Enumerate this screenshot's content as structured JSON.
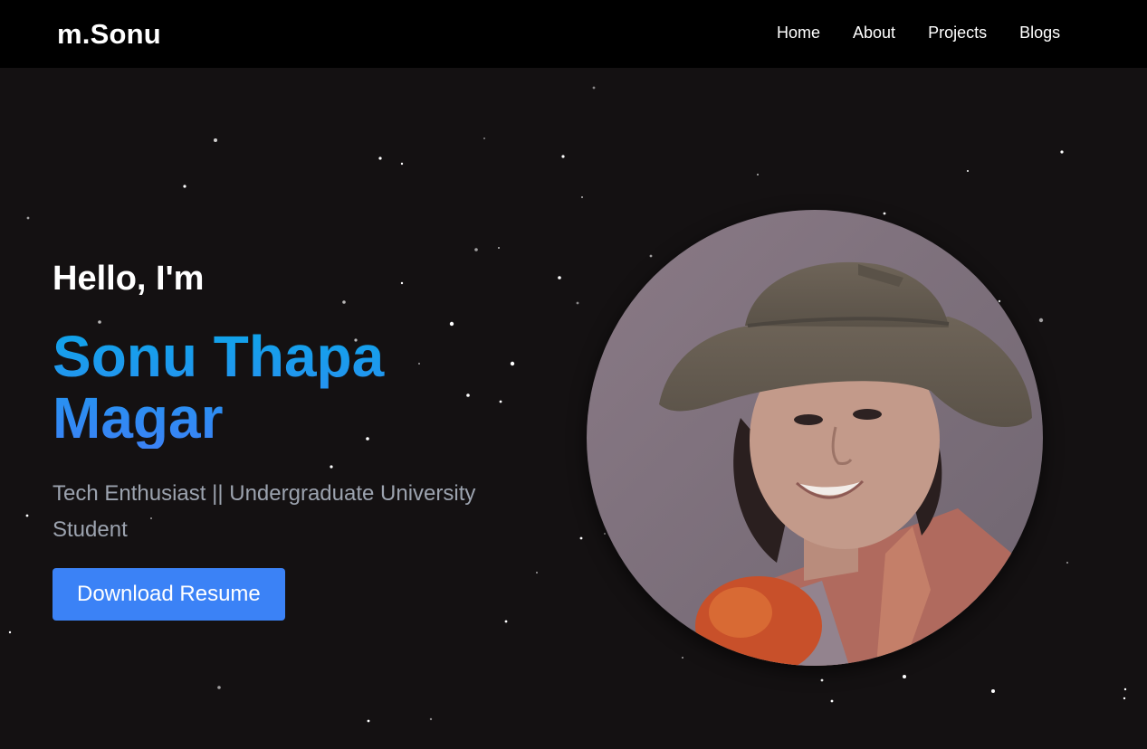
{
  "header": {
    "brand": "m.Sonu",
    "nav": [
      {
        "label": "Home"
      },
      {
        "label": "About"
      },
      {
        "label": "Projects"
      },
      {
        "label": "Blogs"
      }
    ]
  },
  "hero": {
    "greeting": "Hello, I'm",
    "name": "Sonu Thapa Magar",
    "tagline": "Tech Enthusiast || Undergraduate University Student",
    "button_label": "Download Resume",
    "photo_icon": "profile-photo"
  },
  "colors": {
    "background": "#141112",
    "navbar": "#000000",
    "accent": "#3b82f6",
    "name_gradient_top": "#0ea5e9",
    "name_gradient_bottom": "#3b82f6",
    "tagline": "#9ca3af"
  }
}
